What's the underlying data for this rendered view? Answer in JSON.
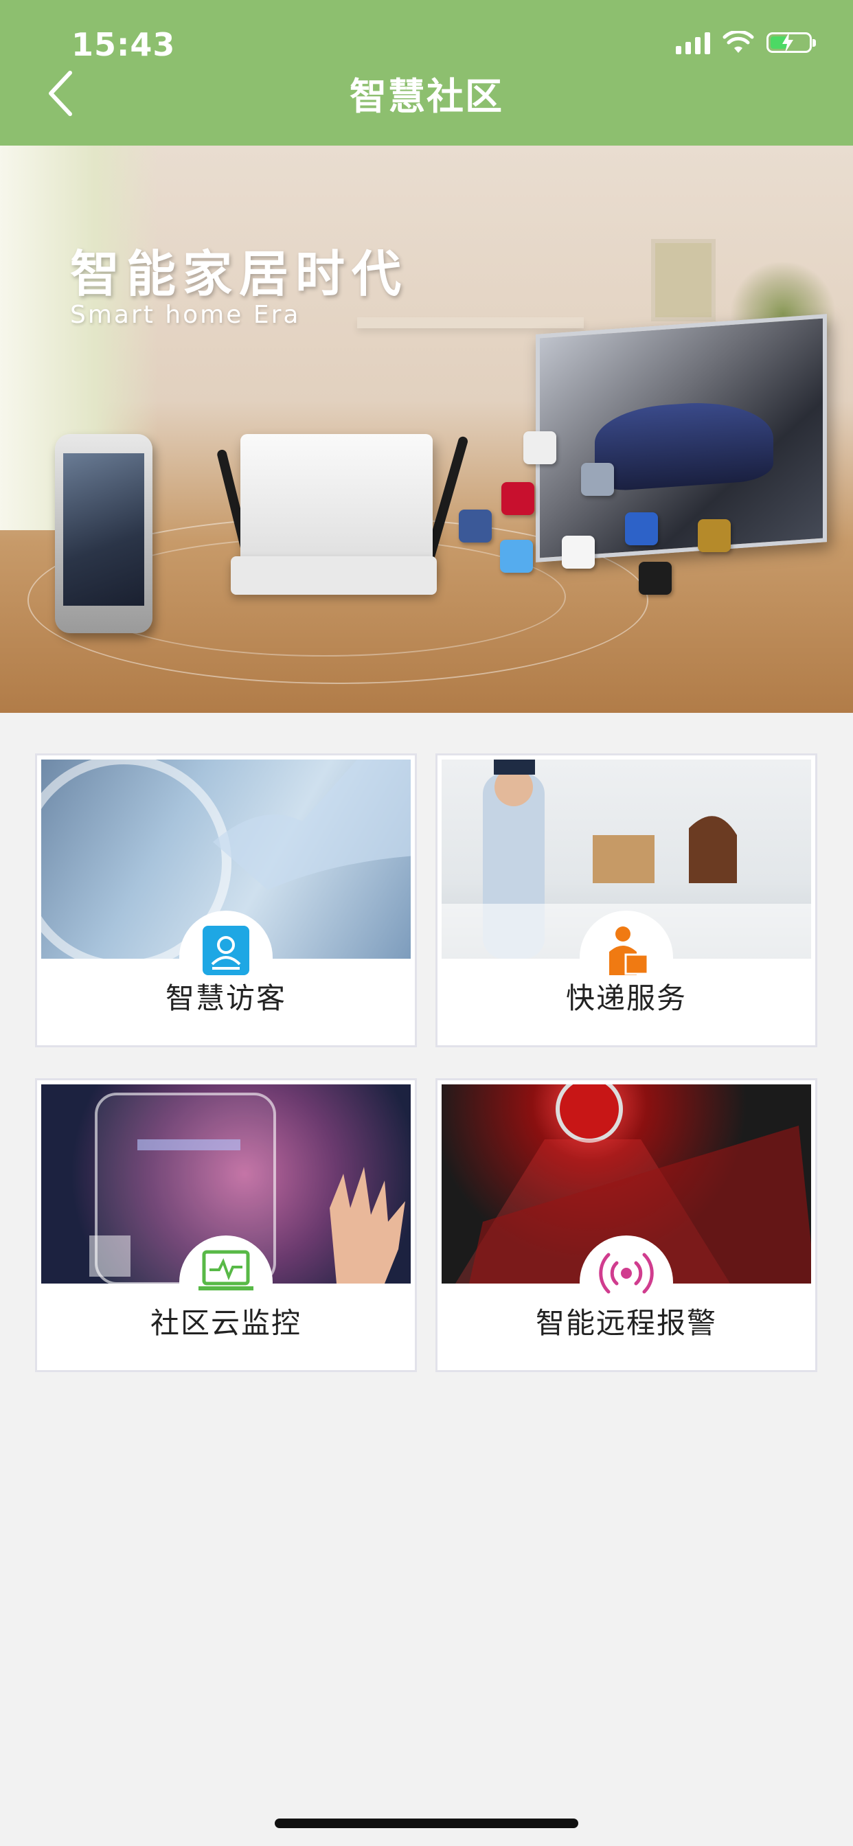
{
  "status_bar": {
    "time": "15:43"
  },
  "header": {
    "title": "智慧社区",
    "back_icon": "chevron-left-icon"
  },
  "banner": {
    "heading": "智能家居时代",
    "subheading": "Smart home Era"
  },
  "services": [
    {
      "label": "智慧访客",
      "icon": "visitor-card-icon",
      "icon_color": "#1ea7e4"
    },
    {
      "label": "快递服务",
      "icon": "courier-icon",
      "icon_color": "#f07a12"
    },
    {
      "label": "社区云监控",
      "icon": "monitor-icon",
      "icon_color": "#58b947"
    },
    {
      "label": "智能远程报警",
      "icon": "broadcast-icon",
      "icon_color": "#d03c8e"
    }
  ],
  "colors": {
    "header_bg": "#8dbf6f",
    "page_bg": "#f2f2f2"
  }
}
